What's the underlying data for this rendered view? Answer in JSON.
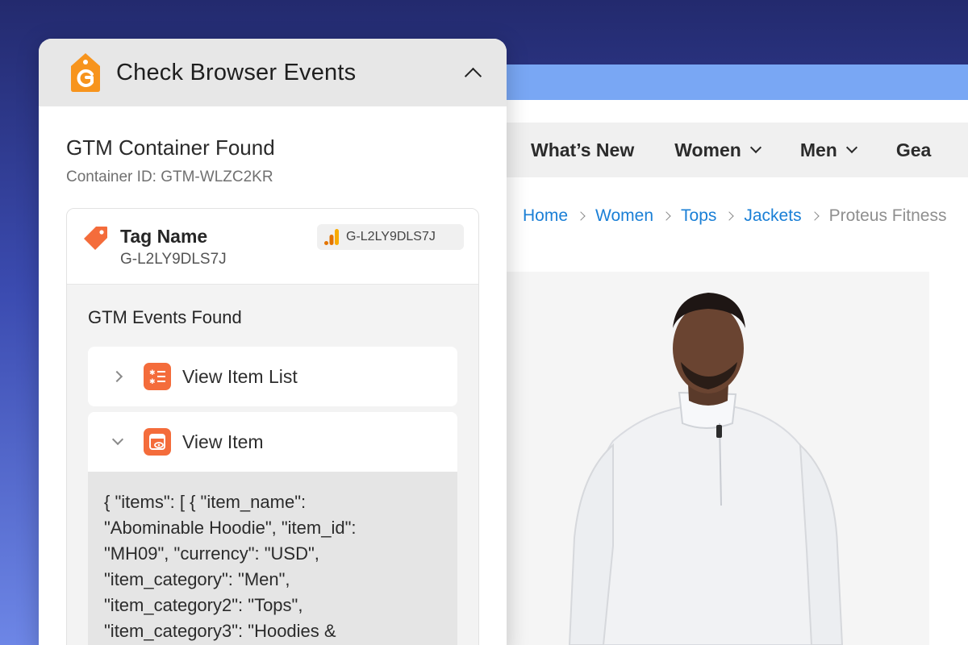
{
  "panel": {
    "title": "Check Browser Events",
    "container_title": "GTM Container Found",
    "container_id": "Container ID: GTM-WLZC2KR",
    "tag": {
      "name_label": "Tag Name",
      "name_value": "G-L2LY9DLS7J",
      "badge": "G-L2LY9DLS7J"
    },
    "events_title": "GTM Events Found",
    "events": [
      {
        "label": "View Item List",
        "expanded": false,
        "icon": "list-icon"
      },
      {
        "label": "View Item",
        "expanded": true,
        "icon": "view-icon"
      }
    ],
    "json_payload": "{ \"items\": [ { \"item_name\":\n\"Abominable Hoodie\", \"item_id\":\n\"MH09\", \"currency\": \"USD\",\n\"item_category\": \"Men\",\n\"item_category2\": \"Tops\",\n\"item_category3\": \"Hoodies &"
  },
  "site": {
    "nav": [
      "What’s New",
      "Women",
      "Men",
      "Gea"
    ],
    "breadcrumb": [
      "Home",
      "Women",
      "Tops",
      "Jackets"
    ],
    "breadcrumb_current": "Proteus Fitness"
  },
  "colors": {
    "accent_orange": "#f46c3b",
    "link_blue": "#1a7fd6",
    "browser_bar": "#79a7f4"
  }
}
